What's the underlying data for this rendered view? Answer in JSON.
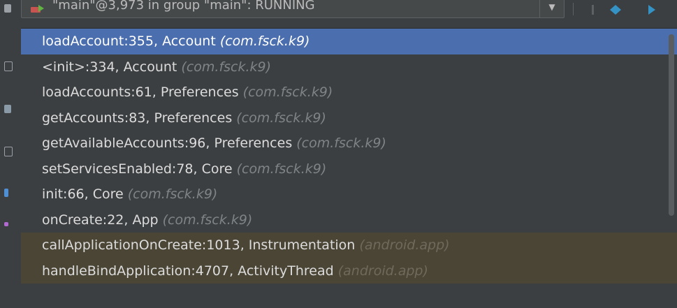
{
  "thread_selector": {
    "text": "\"main\"@3,973 in group \"main\": RUNNING",
    "icon": "thread-running-icon",
    "arrow": "chevron-down-icon"
  },
  "toolbar": {
    "icons": [
      "step-icon",
      "step-into-icon",
      "step-out-icon"
    ]
  },
  "frames": [
    {
      "method": "loadAccount:355, Account",
      "pkg": "(com.fsck.k9)"
    },
    {
      "method": "<init>:334, Account",
      "pkg": "(com.fsck.k9)"
    },
    {
      "method": "loadAccounts:61, Preferences",
      "pkg": "(com.fsck.k9)"
    },
    {
      "method": "getAccounts:83, Preferences",
      "pkg": "(com.fsck.k9)"
    },
    {
      "method": "getAvailableAccounts:96, Preferences",
      "pkg": "(com.fsck.k9)"
    },
    {
      "method": "setServicesEnabled:78, Core",
      "pkg": "(com.fsck.k9)"
    },
    {
      "method": "init:66, Core",
      "pkg": "(com.fsck.k9)"
    },
    {
      "method": "onCreate:22, App",
      "pkg": "(com.fsck.k9)"
    },
    {
      "method": "callApplicationOnCreate:1013, Instrumentation",
      "pkg": "(android.app)"
    },
    {
      "method": "handleBindApplication:4707, ActivityThread",
      "pkg": "(android.app)"
    }
  ],
  "colors": {
    "selection": "#4b6eaf",
    "library_frame": "#4a4535",
    "background": "#3c3f41"
  }
}
